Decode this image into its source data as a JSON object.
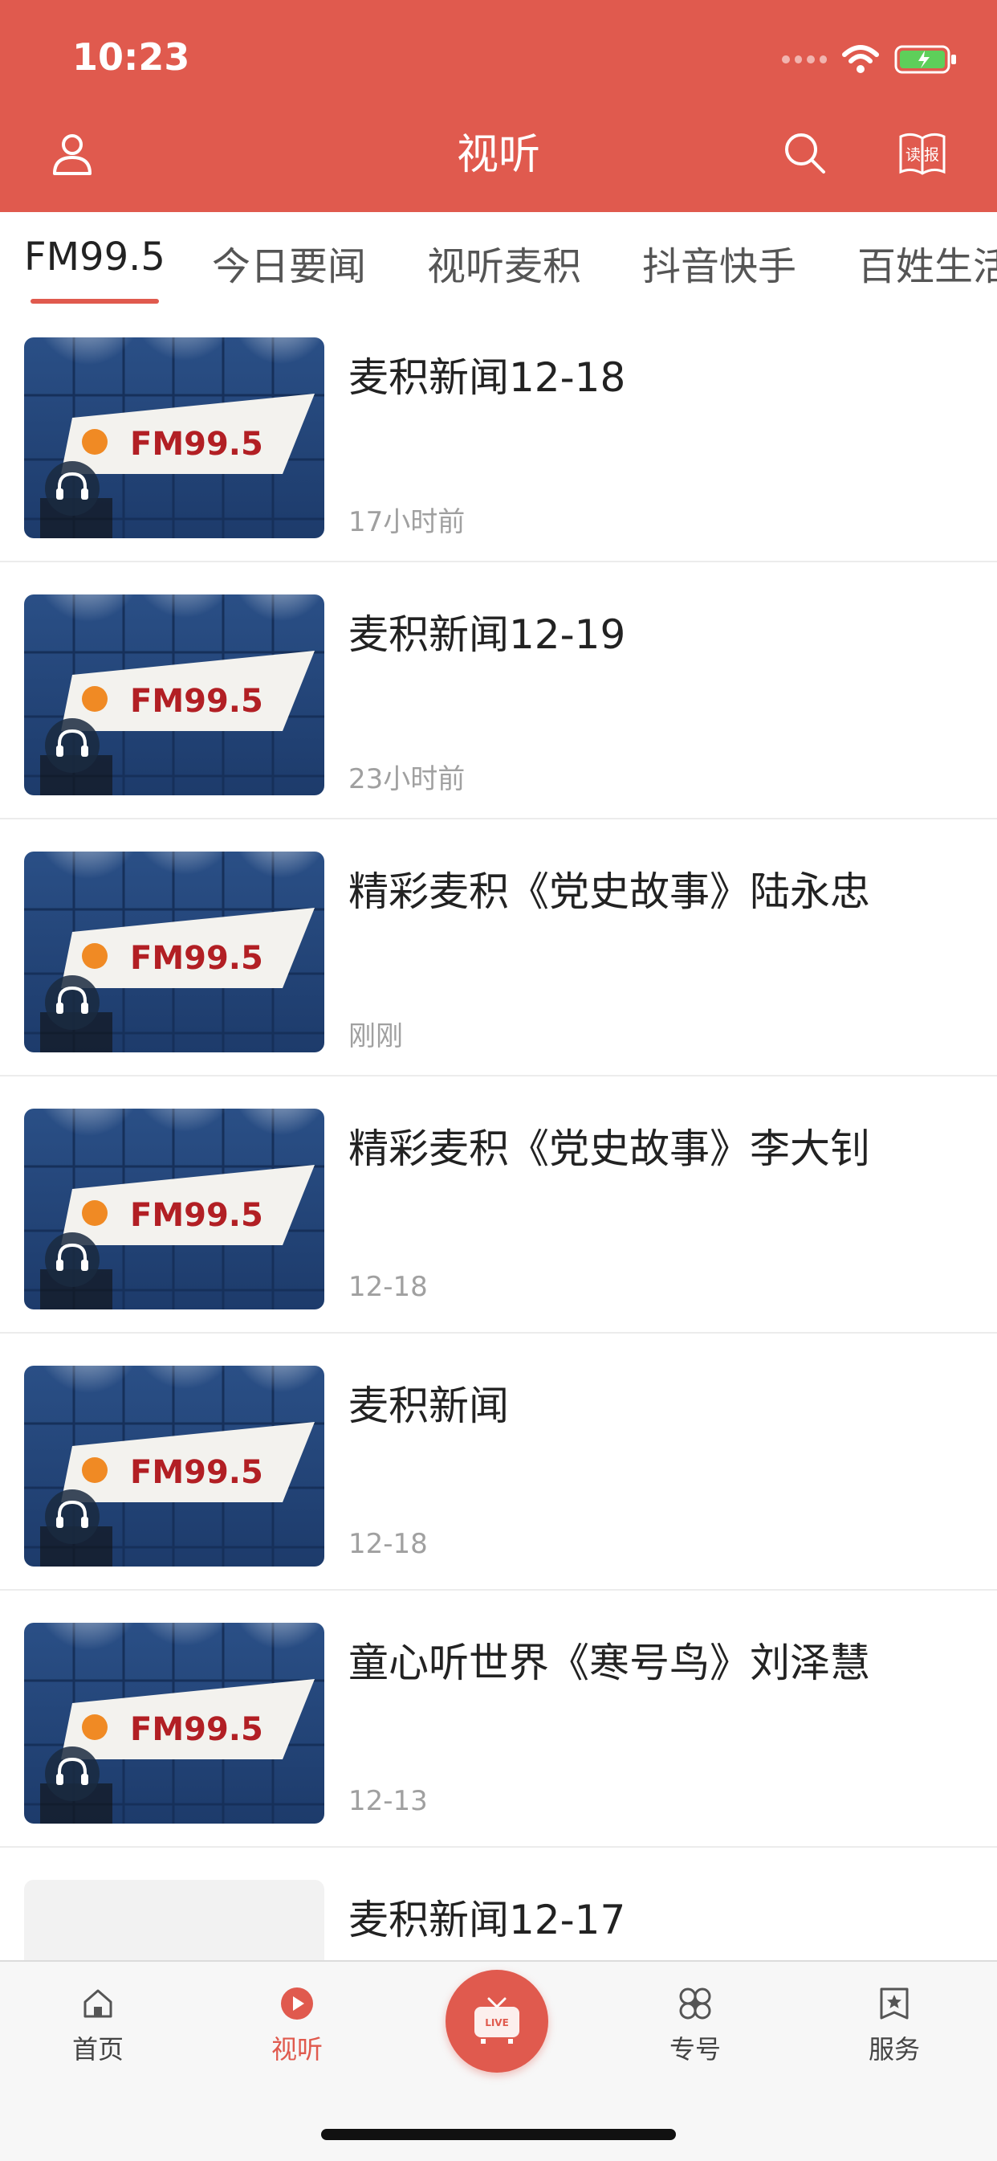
{
  "status": {
    "time": "10:23"
  },
  "header": {
    "title": "视听",
    "read_icon_text": "读报"
  },
  "tabs": [
    "FM99.5",
    "今日要闻",
    "视听麦积",
    "抖音快手",
    "百姓生活"
  ],
  "thumb_logo_text": "FM99.5",
  "items": [
    {
      "title": "麦积新闻12-18",
      "time": "17小时前"
    },
    {
      "title": "麦积新闻12-19",
      "time": "23小时前"
    },
    {
      "title": "精彩麦积《党史故事》陆永忠",
      "time": "刚刚"
    },
    {
      "title": "精彩麦积《党史故事》李大钊",
      "time": "12-18"
    },
    {
      "title": "麦积新闻",
      "time": "12-18"
    },
    {
      "title": "童心听世界《寒号鸟》刘泽慧",
      "time": "12-13"
    },
    {
      "title": "麦积新闻12-17",
      "time": ""
    }
  ],
  "tabbar": {
    "home": "首页",
    "listen": "视听",
    "live": "LIVE",
    "special": "专号",
    "service": "服务"
  },
  "colors": {
    "accent": "#e05a4e"
  },
  "icons": [
    "user-icon",
    "search-icon",
    "newspaper-icon",
    "headphones-icon",
    "home-icon",
    "play-icon",
    "tv-icon",
    "flower-icon",
    "star-icon"
  ]
}
